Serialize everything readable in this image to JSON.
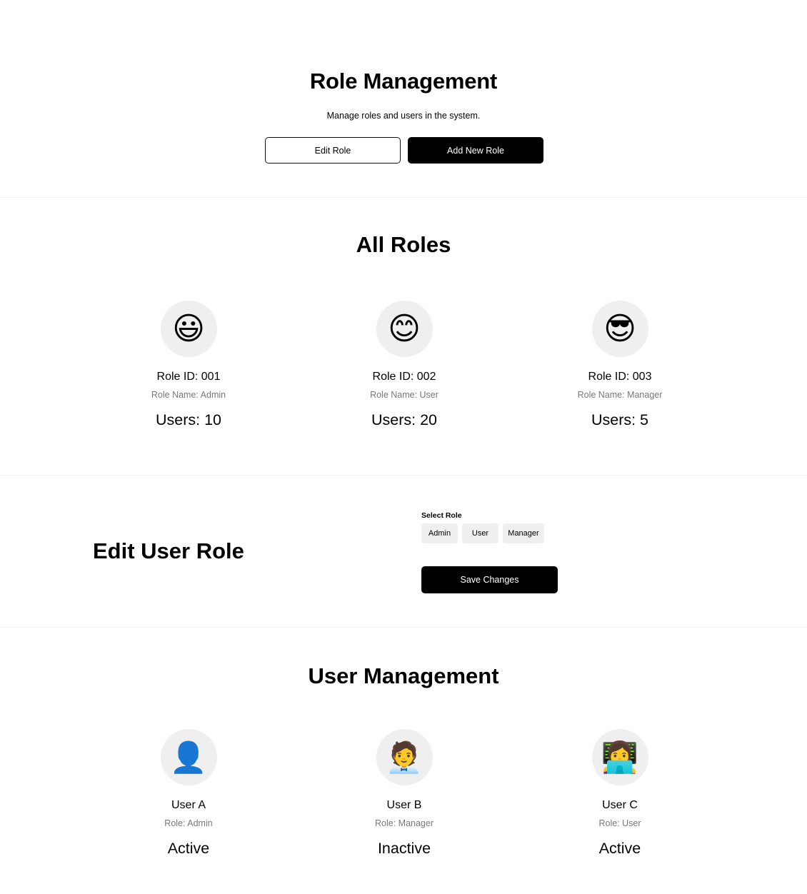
{
  "header": {
    "title": "Role Management",
    "subtitle": "Manage roles and users in the system.",
    "edit_role_label": "Edit Role",
    "add_role_label": "Add New Role"
  },
  "all_roles": {
    "title": "All Roles",
    "roles": [
      {
        "emoji": "😃",
        "icon": "grinning-face-icon",
        "id": "Role ID: 001",
        "name": "Role Name: Admin",
        "users": "Users: 10"
      },
      {
        "emoji": "😊",
        "icon": "smiling-face-icon",
        "id": "Role ID: 002",
        "name": "Role Name: User",
        "users": "Users: 20"
      },
      {
        "emoji": "😎",
        "icon": "sunglasses-face-icon",
        "id": "Role ID: 003",
        "name": "Role Name: Manager",
        "users": "Users: 5"
      }
    ]
  },
  "edit_user_role": {
    "title": "Edit User Role",
    "select_label": "Select Role",
    "options": [
      "Admin",
      "User",
      "Manager"
    ],
    "save_label": "Save Changes"
  },
  "user_management": {
    "title": "User Management",
    "users": [
      {
        "emoji": "👤",
        "icon": "user-silhouette-icon",
        "name": "User A",
        "role": "Role: Admin",
        "status": "Active"
      },
      {
        "emoji": "🧑‍💼",
        "icon": "office-worker-icon",
        "name": "User B",
        "role": "Role: Manager",
        "status": "Inactive"
      },
      {
        "emoji": "👩‍💻",
        "icon": "technologist-icon",
        "name": "User C",
        "role": "Role: User",
        "status": "Active"
      }
    ]
  }
}
